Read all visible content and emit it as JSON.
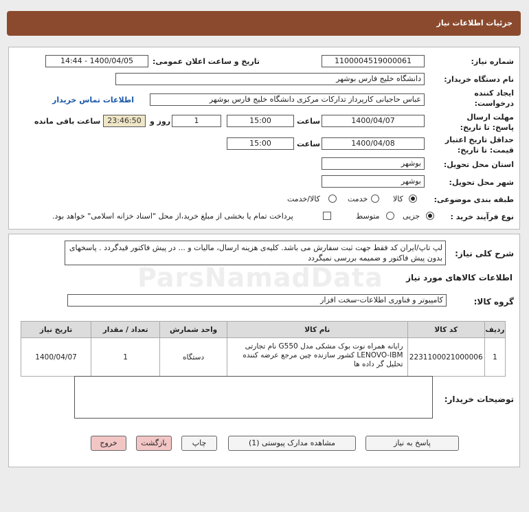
{
  "header": {
    "title": "جزئیات اطلاعات نیاز"
  },
  "form": {
    "need_number_label": "شماره نیاز:",
    "need_number": "1100004519000061",
    "announce_label": "تاریخ و ساعت اعلان عمومی:",
    "announce_value": "1400/04/05 - 14:44",
    "buyer_org_label": "نام دستگاه خریدار:",
    "buyer_org": "دانشگاه خلیج فارس بوشهر",
    "creator_label": "ایجاد کننده درخواست:",
    "creator": "عباس حاجیانی کارپرداز تدارکات مرکزی دانشگاه خلیج فارس بوشهر",
    "contact_link": "اطلاعات تماس خریدار",
    "reply_deadline_label": "مهلت ارسال پاسخ: تا تاریخ:",
    "reply_date": "1400/04/07",
    "time_label": "ساعت",
    "reply_time": "15:00",
    "day_label": "روز و",
    "days": "1",
    "remaining": "23:46:50",
    "remaining_label": "ساعت باقی مانده",
    "validity_label": "حداقل تاریخ اعتبار قیمت: تا تاریخ:",
    "validity_date": "1400/04/08",
    "validity_time": "15:00",
    "province_label": "استان محل تحویل:",
    "province": "بوشهر",
    "city_label": "شهر محل تحویل:",
    "city": "بوشهر",
    "category_label": "طبقه بندی موضوعی:",
    "cat_goods": "کالا",
    "cat_service": "خدمت",
    "cat_goods_service": "کالا/خدمت",
    "process_label": "نوع فرآیند خرید :",
    "proc_partial": "جزیی",
    "proc_medium": "متوسط",
    "payment_note": "پرداخت تمام یا بخشی از مبلغ خرید،از محل \"اسناد خزانه اسلامی\" خواهد بود."
  },
  "details": {
    "general_desc_label": "شرح کلی نیاز:",
    "general_desc": "لپ تاپ/ایران کد فقط جهت ثبت سفارش می باشد. کلیه‌ی هزینه ارسال، مالیات و ... در پیش فاکتور قیدگردد . پاسخهای بدون پیش فاکتور و ضمیمه بررسی نمیگردد",
    "goods_info_title": "اطلاعات کالاهای مورد نیاز",
    "goods_group_label": "گروه کالا:",
    "goods_group": "کامپیوتر و فناوری اطلاعات-سخت افزار",
    "table_headers": [
      "ردیف",
      "کد کالا",
      "نام کالا",
      "واحد شمارش",
      "تعداد / مقدار",
      "تاریخ نیاز"
    ],
    "rows": [
      {
        "idx": "1",
        "code": "2231100021000006",
        "name": "رایانه همراه نوت بوک مشکی مدل G550 نام تجارتی LENOVO-IBM کشور سازنده چین مرجع عرضه کننده تحلیل گر داده ها",
        "unit": "دستگاه",
        "qty": "1",
        "date": "1400/04/07"
      }
    ],
    "buyer_desc_label": "توضیحات خریدار:"
  },
  "watermark": "ParsNamadData",
  "buttons": {
    "reply": "پاسخ به نیاز",
    "attachments": "مشاهده مدارک پیوستی (1)",
    "print": "چاپ",
    "back": "بازگشت",
    "exit": "خروج"
  }
}
